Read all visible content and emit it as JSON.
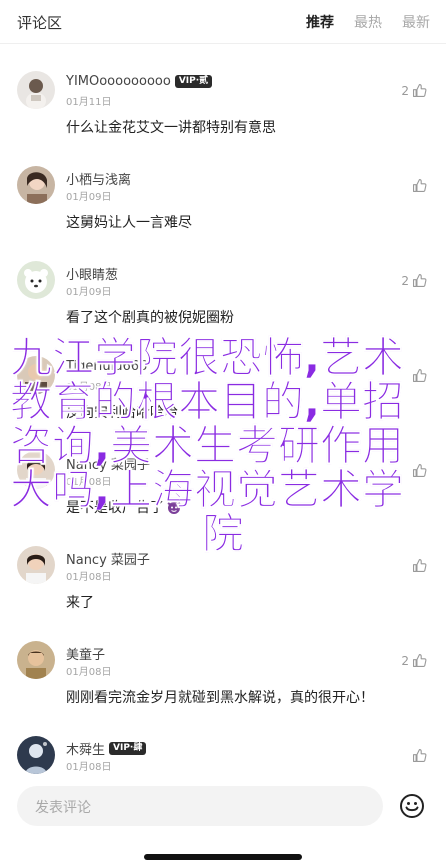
{
  "header": {
    "title": "评论区",
    "tabs": [
      {
        "label": "推荐",
        "active": true
      },
      {
        "label": "最热",
        "active": false
      },
      {
        "label": "最新",
        "active": false
      }
    ]
  },
  "comments": [
    {
      "name": "YIMOooooooooo",
      "badge": "VIP·贰",
      "date": "01月11日",
      "text": "什么让金花艾文一讲都特别有意思",
      "likes": "2"
    },
    {
      "name": "小栖与浅离",
      "badge": "",
      "date": "01月09日",
      "text": "这舅妈让人一言难尽",
      "likes": ""
    },
    {
      "name": "小眼睛葱",
      "badge": "",
      "date": "01月09日",
      "text": "看了这个剧真的被倪妮圈粉",
      "likes": "2"
    },
    {
      "name": "Tigerlulu666",
      "badge": "",
      "date": "01月08日",
      "text": "反向安利哈哈哈哈",
      "likes": ""
    },
    {
      "name": "Nancy 菜园子",
      "badge": "",
      "date": "01月08日",
      "text": "是不是收广告了",
      "likes": ""
    },
    {
      "name": "Nancy 菜园子",
      "badge": "",
      "date": "01月08日",
      "text": "来了",
      "likes": ""
    },
    {
      "name": "美童子",
      "badge": "",
      "date": "01月08日",
      "text": "刚刚看完流金岁月就碰到黑水解说，真的很开心！",
      "likes": "2"
    },
    {
      "name": "木舜生",
      "badge": "VIP·肆",
      "date": "01月08日",
      "text": "",
      "likes": ""
    }
  ],
  "overlay": {
    "lines": [
      "九江学院很恐怖,艺术",
      "教育的根本目的,单招",
      "咨询,美术生考研作用",
      "大吗,上海视觉艺术学",
      "院"
    ]
  },
  "footer": {
    "input_placeholder": "发表评论",
    "emoji_icon": "emoji-smile-icon"
  },
  "colors": {
    "overlay_text": "#8a2be2",
    "vip_badge_bg": "#2b2b2b",
    "active_tab": "#222222",
    "inactive_tab": "#a8a8a8"
  }
}
